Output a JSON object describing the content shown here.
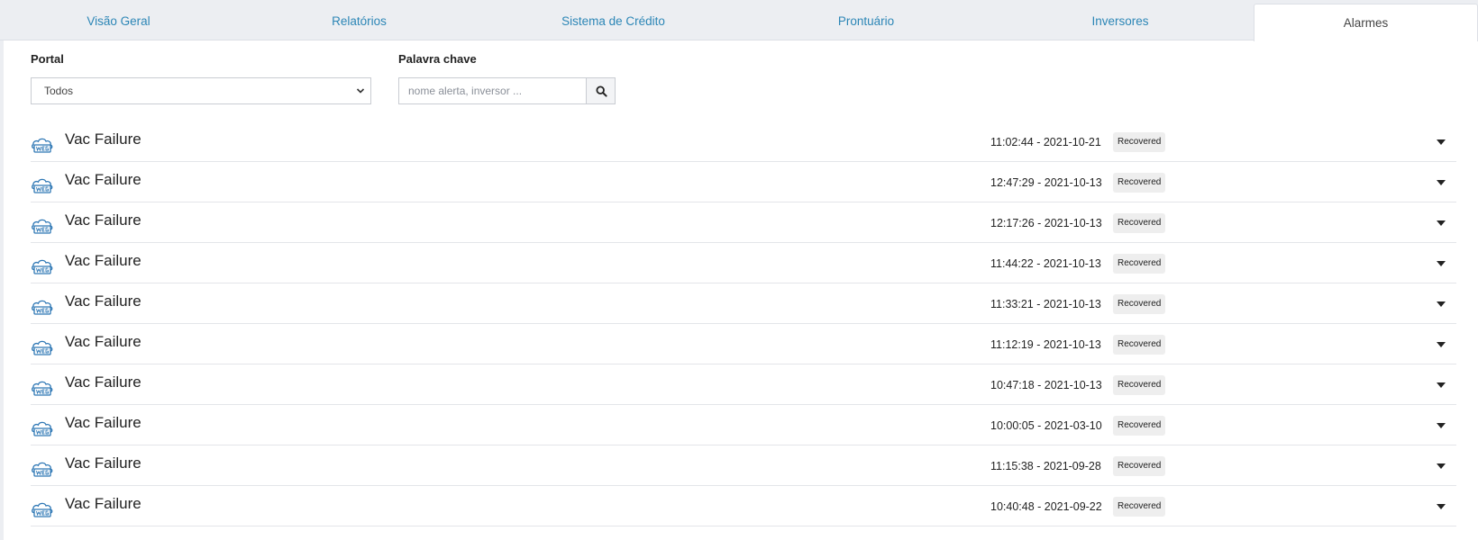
{
  "tabs": [
    {
      "label": "Visão Geral"
    },
    {
      "label": "Relatórios"
    },
    {
      "label": "Sistema de Crédito"
    },
    {
      "label": "Prontuário"
    },
    {
      "label": "Inversores"
    },
    {
      "label": "Alarmes",
      "active": true
    }
  ],
  "filters": {
    "portal_label": "Portal",
    "portal_value": "Todos",
    "keyword_label": "Palavra chave",
    "keyword_placeholder": "nome alerta, inversor ...",
    "keyword_value": ""
  },
  "alarms": [
    {
      "name": "Vac Failure",
      "time": "11:02:44 - 2021-10-21",
      "status": "Recovered"
    },
    {
      "name": "Vac Failure",
      "time": "12:47:29 - 2021-10-13",
      "status": "Recovered"
    },
    {
      "name": "Vac Failure",
      "time": "12:17:26 - 2021-10-13",
      "status": "Recovered"
    },
    {
      "name": "Vac Failure",
      "time": "11:44:22 - 2021-10-13",
      "status": "Recovered"
    },
    {
      "name": "Vac Failure",
      "time": "11:33:21 - 2021-10-13",
      "status": "Recovered"
    },
    {
      "name": "Vac Failure",
      "time": "11:12:19 - 2021-10-13",
      "status": "Recovered"
    },
    {
      "name": "Vac Failure",
      "time": "10:47:18 - 2021-10-13",
      "status": "Recovered"
    },
    {
      "name": "Vac Failure",
      "time": "10:00:05 - 2021-03-10",
      "status": "Recovered"
    },
    {
      "name": "Vac Failure",
      "time": "11:15:38 - 2021-09-28",
      "status": "Recovered"
    },
    {
      "name": "Vac Failure",
      "time": "10:40:48 - 2021-09-22",
      "status": "Recovered"
    }
  ],
  "icons": {
    "alarm_logo": "weg-cloud-logo",
    "dropdown": "chevron-down-icon",
    "search": "search-icon",
    "expand": "caret-down-icon"
  },
  "colors": {
    "tab_link": "#2c86b6",
    "logo": "#2f78b5",
    "badge_bg": "#eeeeee"
  }
}
